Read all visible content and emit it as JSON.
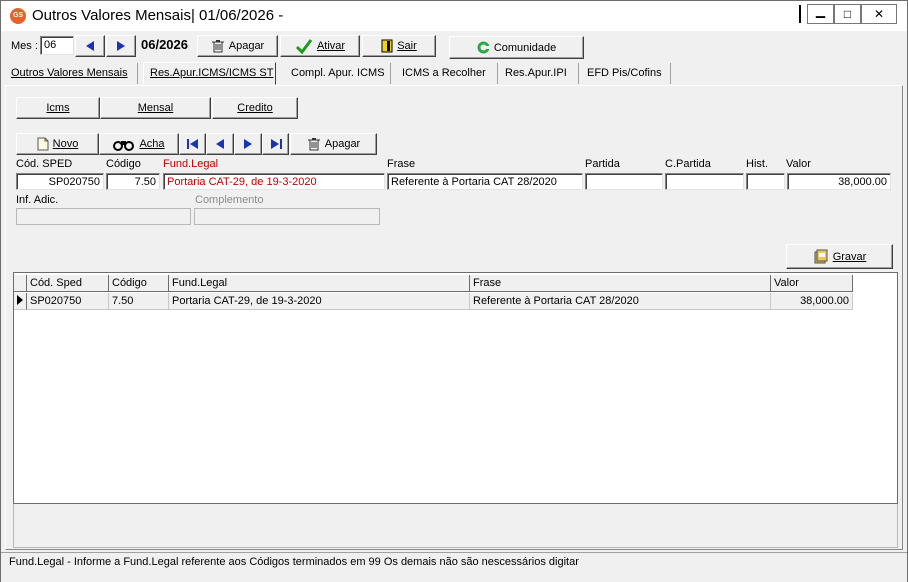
{
  "window": {
    "app_badge": "GS",
    "title": "Outros Valores Mensais|  01/06/2026 -",
    "minimize_glyph": "▁",
    "maximize_glyph": "□",
    "close_glyph": "✕"
  },
  "toolbar": {
    "mes_label": "Mes :",
    "mes_value": "06",
    "period": "06/2026",
    "apagar": "Apagar",
    "ativar": "Ativar",
    "sair": "Sair",
    "comunidade": "Comunidade"
  },
  "tabs": [
    {
      "label": "Outros Valores Mensais"
    },
    {
      "label": "Res.Apur.ICMS/ICMS ST"
    },
    {
      "label": "Compl. Apur. ICMS"
    },
    {
      "label": "ICMS a Recolher"
    },
    {
      "label": "Res.Apur.IPI"
    },
    {
      "label": "EFD Pis/Cofins"
    }
  ],
  "subtabs": {
    "icms": "Icms",
    "mensal": "Mensal",
    "credito": "Credito"
  },
  "nav": {
    "novo": "Novo",
    "acha": "Acha",
    "apagar": "Apagar"
  },
  "form": {
    "labels": {
      "cod_sped": "Cód. SPED",
      "codigo": "Código",
      "fund_legal": "Fund.Legal",
      "frase": "Frase",
      "partida": "Partida",
      "c_partida": "C.Partida",
      "hist": "Hist.",
      "valor": "Valor",
      "inf_adic": "Inf. Adic.",
      "complemento": "Complemento"
    },
    "values": {
      "cod_sped": "SP020750",
      "codigo": "7.50",
      "fund_legal": "Portaria CAT-29, de 19-3-2020",
      "frase": "Referente à Portaria CAT 28/2020",
      "partida": "",
      "c_partida": "",
      "hist": "",
      "valor": "38,000.00",
      "inf_adic": "",
      "complemento": ""
    },
    "gravar": "Gravar"
  },
  "grid": {
    "columns": [
      "Cód. Sped",
      "Código",
      "Fund.Legal",
      "Frase",
      "Valor"
    ],
    "rows": [
      [
        "SP020750",
        "7.50",
        "Portaria CAT-29, de 19-3-2020",
        "Referente à Portaria CAT 28/2020",
        "38,000.00"
      ]
    ]
  },
  "status": {
    "message": "Fund.Legal - Informe a Fund.Legal referente aos Códigos terminados em 99 Os demais não são nescessários digitar"
  },
  "colors": {
    "accent_red": "#c00000",
    "nav_blue": "#1a33b5",
    "ativar_green": "#1c9a1c"
  }
}
